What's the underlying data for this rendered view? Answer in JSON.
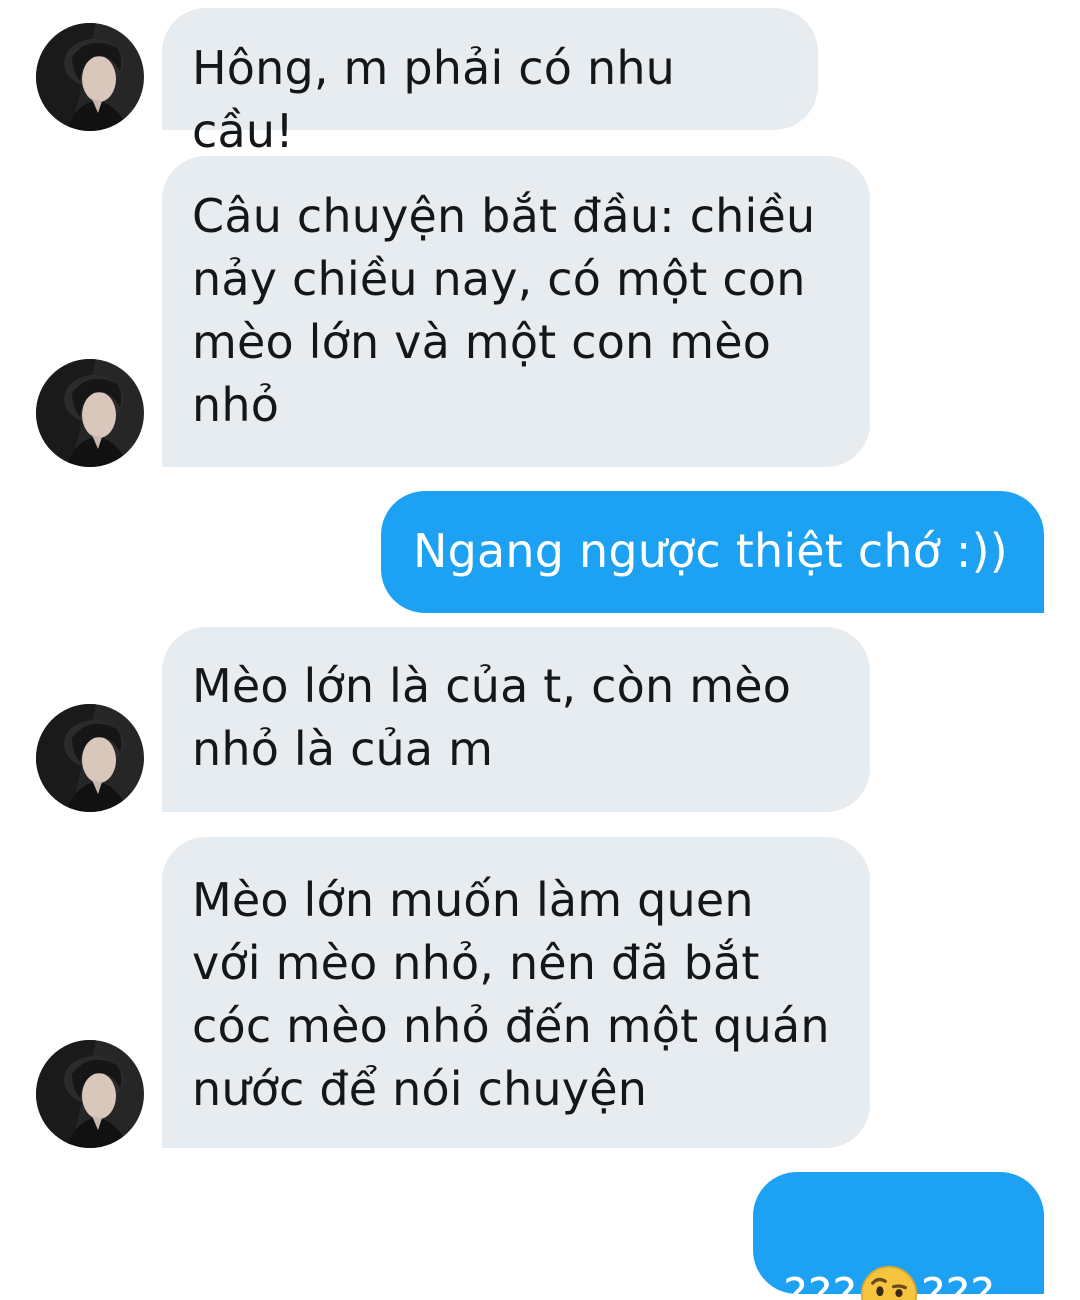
{
  "conversation": {
    "messages": [
      {
        "direction": "incoming",
        "text": "Hông, m phải có nhu cầu!"
      },
      {
        "direction": "incoming",
        "text": "Câu chuyện bắt đầu: chiều\nnảy chiều nay, có một con\nmèo lớn và một con mèo\nnhỏ"
      },
      {
        "direction": "outgoing",
        "text": "Ngang ngược thiệt chớ :))"
      },
      {
        "direction": "incoming",
        "text": "Mèo lớn là của t, còn mèo\nnhỏ là của m"
      },
      {
        "direction": "incoming",
        "text": "Mèo lớn muốn làm quen\nvới mèo nhỏ, nên đã bắt\ncóc mèo nhỏ đến một quán\nnước để nói chuyện"
      },
      {
        "direction": "outgoing",
        "text_before": "???",
        "emoji": "face-with-raised-eyebrow",
        "text_after": "???"
      }
    ]
  },
  "colors": {
    "incoming_bubble": "#e6ecf0",
    "outgoing_bubble": "#1da1f2",
    "incoming_text": "#14171a",
    "outgoing_text": "#ffffff"
  }
}
